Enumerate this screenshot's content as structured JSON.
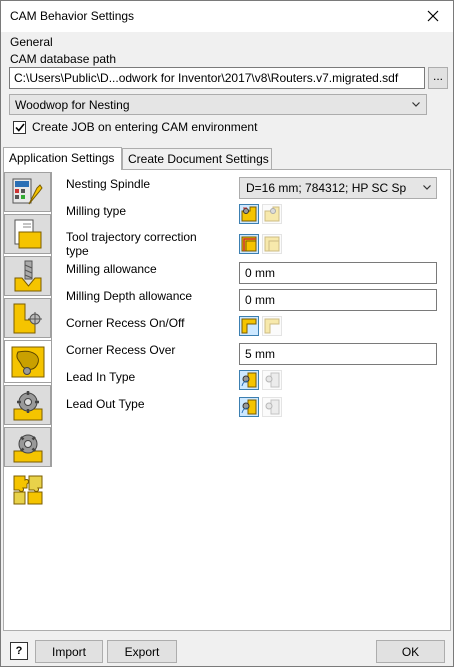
{
  "window": {
    "title": "CAM Behavior Settings"
  },
  "general": {
    "group_label": "General",
    "db_label": "CAM database path",
    "db_path": "C:\\Users\\Public\\D...odwork for Inventor\\2017\\v8\\Routers.v7.migrated.sdf",
    "browse_label": "...",
    "machine_selected": "Woodwop for Nesting",
    "create_job_label": "Create JOB on entering CAM environment",
    "create_job_checked": true
  },
  "tabs": [
    "Application Settings",
    "Create Document Settings"
  ],
  "sidebar_icons": [
    "machine-settings-icon",
    "document-icon",
    "drill-tool-icon",
    "contour-milling-icon",
    "nesting-shape-icon",
    "gear-settings-icon",
    "gear-settings-alt-icon",
    "puzzle-icon"
  ],
  "properties": {
    "nesting_spindle_label": "Nesting Spindle",
    "nesting_spindle_value": "D=16 mm; 784312; HP SC Sp",
    "milling_type_label": "Milling type",
    "tool_traj_label_1": "Tool trajectory correction",
    "tool_traj_label_2": "type",
    "milling_allowance_label": "Milling allowance",
    "milling_allowance_value": "0 mm",
    "milling_depth_label": "Milling Depth allowance",
    "milling_depth_value": "0 mm",
    "corner_recess_label": "Corner Recess On/Off",
    "corner_recess_over_label": "Corner Recess Over",
    "corner_recess_over_value": "5 mm",
    "lead_in_label": "Lead In Type",
    "lead_out_label": "Lead Out Type"
  },
  "footer": {
    "help_label": "?",
    "import_label": "Import",
    "export_label": "Export",
    "ok_label": "OK"
  },
  "colors": {
    "accent_blue": "#3c7fb1",
    "icon_yellow": "#f5c400",
    "selected_bg": "#cde8ff"
  }
}
